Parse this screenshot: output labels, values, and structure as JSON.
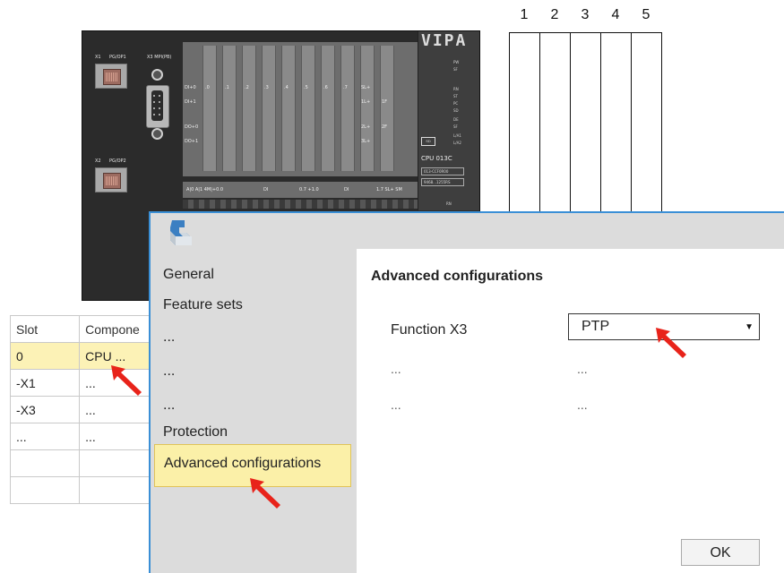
{
  "module": {
    "brand": "VIPA",
    "port_x1": "X1",
    "port_x1_sub": "PG/OP1",
    "port_x2": "X2",
    "port_x2_sub": "PG/OP2",
    "port_x3": "X3 MPI(PB)",
    "io_rows": [
      "DI+0",
      "DI+1",
      "DO+0",
      "DO+1"
    ],
    "io_cols": [
      ".0",
      ".1",
      ".2",
      ".3",
      ".4",
      ".5",
      ".6",
      ".7"
    ],
    "io_row_end": [
      "SL+",
      "1L+",
      "2L+",
      "3L+"
    ],
    "io_row_end2": [
      "",
      "1F",
      "2F",
      ""
    ],
    "term_labels": [
      "A|0 A|1 4M|+0.0",
      "DI",
      "0.7 +1.0",
      "DI",
      "1.7 SL+ SM"
    ],
    "leds": [
      "PW",
      "SF",
      "RN",
      "ST",
      "PC",
      "SD",
      "DE",
      "SF",
      "L/A1",
      "L/A2"
    ],
    "sd_label": "SD",
    "cpu_name": "CPU 013C",
    "cpu_order": "013-CCF0R00",
    "cpu_serial": "9468...1255RS",
    "rn_label": "RN"
  },
  "slots": [
    "1",
    "2",
    "3",
    "4",
    "5"
  ],
  "table": {
    "headers": [
      "Slot",
      "Compone"
    ],
    "rows": [
      [
        "0",
        "CPU ..."
      ],
      [
        "-X1",
        "..."
      ],
      [
        "-X3",
        "..."
      ],
      [
        "...",
        "..."
      ],
      [
        "",
        ""
      ],
      [
        "",
        ""
      ]
    ]
  },
  "dialog": {
    "nav": [
      "General",
      "Feature sets",
      "...",
      "...",
      "...",
      "Protection",
      "Advanced configurations"
    ],
    "content_title": "Advanced configurations",
    "field_label": "Function X3",
    "field_value": "PTP",
    "dots": [
      "...",
      "...",
      "...",
      "..."
    ],
    "ok_label": "OK"
  },
  "colors": {
    "highlight": "#fbf0a8",
    "table_selected": "#fcf2b6",
    "arrow": "#e8231a",
    "dialog_border": "#3a8fd6"
  }
}
